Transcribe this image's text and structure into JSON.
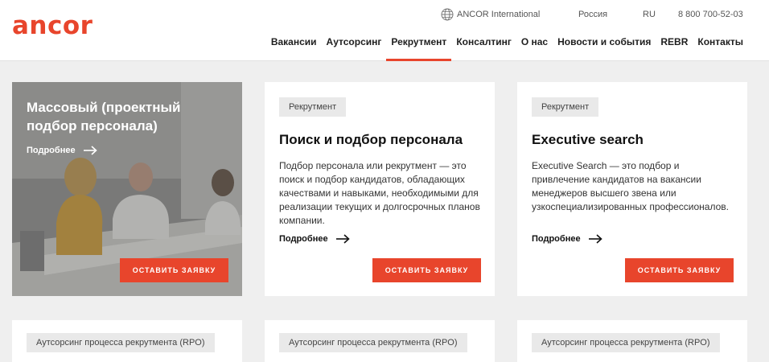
{
  "header": {
    "logo": "ancor",
    "international": "ANCOR International",
    "country": "Россия",
    "language": "RU",
    "phone": "8 800 700-52-03",
    "accent_color": "#e8452c"
  },
  "nav": {
    "items": [
      {
        "label": "Вакансии",
        "active": false
      },
      {
        "label": "Аутсорсинг",
        "active": false
      },
      {
        "label": "Рекрутмент",
        "active": true
      },
      {
        "label": "Консалтинг",
        "active": false
      },
      {
        "label": "О нас",
        "active": false
      },
      {
        "label": "Новости и события",
        "active": false
      },
      {
        "label": "REBR",
        "active": false
      },
      {
        "label": "Контакты",
        "active": false
      }
    ]
  },
  "cards": [
    {
      "title": "Массовый (проектный подбор персонала)",
      "more": "Подробнее",
      "button": "ОСТАВИТЬ ЗАЯВКУ"
    },
    {
      "tag": "Рекрутмент",
      "title": "Поиск и подбор персонала",
      "description": "Подбор персонала или рекрутмент — это поиск и подбор кандидатов, обладающих качествами и навыками, необходимыми для реализации текущих и долгосрочных планов компании.",
      "more": "Подробнее",
      "button": "ОСТАВИТЬ ЗАЯВКУ"
    },
    {
      "tag": "Рекрутмент",
      "title": "Executive search",
      "description": "Executive Search — это подбор и привлечение кандидатов на вакансии менеджеров высшего звена или узкоспециализированных профессионалов.",
      "more": "Подробнее",
      "button": "ОСТАВИТЬ ЗАЯВКУ"
    },
    {
      "tag": "Аутсорсинг процесса рекрутмента (RPO)"
    },
    {
      "tag": "Аутсорсинг процесса рекрутмента (RPO)"
    },
    {
      "tag": "Аутсорсинг процесса рекрутмента (RPO)"
    }
  ],
  "icons": {
    "globe": "globe-icon",
    "arrow": "arrow-right-icon"
  }
}
